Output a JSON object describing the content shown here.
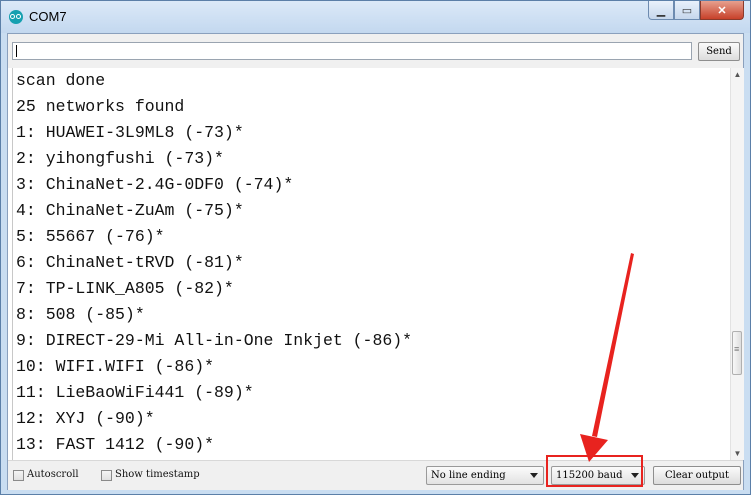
{
  "window": {
    "title": "COM7"
  },
  "send_row": {
    "input_value": "",
    "send_label": "Send"
  },
  "output_lines": [
    "scan done",
    "25 networks found",
    "1: HUAWEI-3L9ML8 (-73)*",
    "2: yihongfushi (-73)*",
    "3: ChinaNet-2.4G-0DF0 (-74)*",
    "4: ChinaNet-ZuAm (-75)*",
    "5: 55667 (-76)*",
    "6: ChinaNet-tRVD (-81)*",
    "7: TP-LINK_A805 (-82)*",
    "8: 508 (-85)*",
    "9: DIRECT-29-Mi All-in-One Inkjet (-86)*",
    "10: WIFI.WIFI (-86)*",
    "11: LieBaoWiFi441 (-89)*",
    "12: XYJ (-90)*",
    "13: FAST 1412 (-90)*"
  ],
  "bottom": {
    "autoscroll_label": "Autoscroll",
    "autoscroll_checked": false,
    "timestamp_label": "Show timestamp",
    "timestamp_checked": false,
    "line_ending": "No line ending",
    "baud": "115200 baud",
    "clear_label": "Clear output"
  },
  "annotation": {
    "color": "#e8231f"
  }
}
